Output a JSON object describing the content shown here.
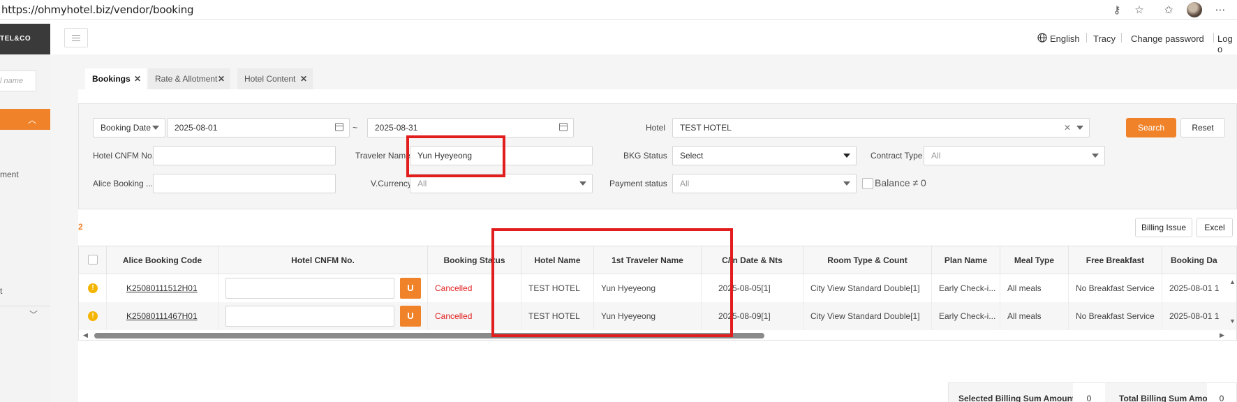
{
  "browser": {
    "url": "https://ohmyhotel.biz/vendor/booking",
    "icons": [
      "key-icon",
      "star-icon",
      "favorites-icon",
      "more-icon"
    ]
  },
  "sidebar": {
    "logo": "TEL&CO",
    "search_placeholder": "l name",
    "partial_item_1": "ment",
    "partial_item_2": "t"
  },
  "header": {
    "language": "English",
    "user": "Tracy",
    "change_password": "Change password",
    "logout": "Log o"
  },
  "tabs": [
    {
      "label": "Bookings"
    },
    {
      "label": "Rate & Allotment"
    },
    {
      "label": "Hotel Content"
    }
  ],
  "filters": {
    "date_type": "Booking Date",
    "date_from": "2025-08-01",
    "date_sep": "~",
    "date_to": "2025-08-31",
    "hotel_label": "Hotel",
    "hotel_value": "TEST HOTEL",
    "search_button": "Search",
    "reset_button": "Reset",
    "hotel_cnfm_label": "Hotel CNFM No.",
    "hotel_cnfm_value": "",
    "traveler_label": "Traveler Name",
    "traveler_value": "Yun Hyeyeong",
    "bkg_status_label": "BKG Status",
    "bkg_status_value": "Select",
    "contract_type_label": "Contract Type",
    "contract_type_value": "All",
    "alice_booking_label": "Alice Booking ...",
    "alice_booking_value": "",
    "vcurrency_label": "V.Currency",
    "vcurrency_value": "All",
    "payment_status_label": "Payment status",
    "payment_status_value": "All",
    "balance_label": "Balance ≠ 0"
  },
  "results": {
    "count": "2",
    "billing_issue_button": "Billing Issue",
    "excel_button": "Excel"
  },
  "table": {
    "columns": [
      "Alice Booking Code",
      "Hotel CNFM No.",
      "Booking Status",
      "Hotel Name",
      "1st Traveler Name",
      "C/In Date & Nts",
      "Room Type & Count",
      "Plan Name",
      "Meal Type",
      "Free Breakfast",
      "Booking Da"
    ],
    "rows": [
      {
        "code": "K25080111512H01",
        "u": "U",
        "status": "Cancelled",
        "hotel": "TEST HOTEL",
        "traveler": "Yun Hyeyeong",
        "checkin": "2025-08-05[1]",
        "room": "City View Standard Double[1]",
        "plan": "Early Check-i...",
        "meal": "All meals",
        "breakfast": "No Breakfast Service",
        "booking_date": "2025-08-01 1"
      },
      {
        "code": "K25080111467H01",
        "u": "U",
        "status": "Cancelled",
        "hotel": "TEST HOTEL",
        "traveler": "Yun Hyeyeong",
        "checkin": "2025-08-09[1]",
        "room": "City View Standard Double[1]",
        "plan": "Early Check-i...",
        "meal": "All meals",
        "breakfast": "No Breakfast Service",
        "booking_date": "2025-08-01 1"
      }
    ]
  },
  "summary": {
    "selected_label": "Selected Billing Sum Amount",
    "selected_value": "0",
    "total_label": "Total Billing Sum Amount",
    "total_value": "0"
  },
  "colors": {
    "accent": "#f0832a",
    "highlight": "#e11d1d",
    "cancelled": "#e02020"
  }
}
